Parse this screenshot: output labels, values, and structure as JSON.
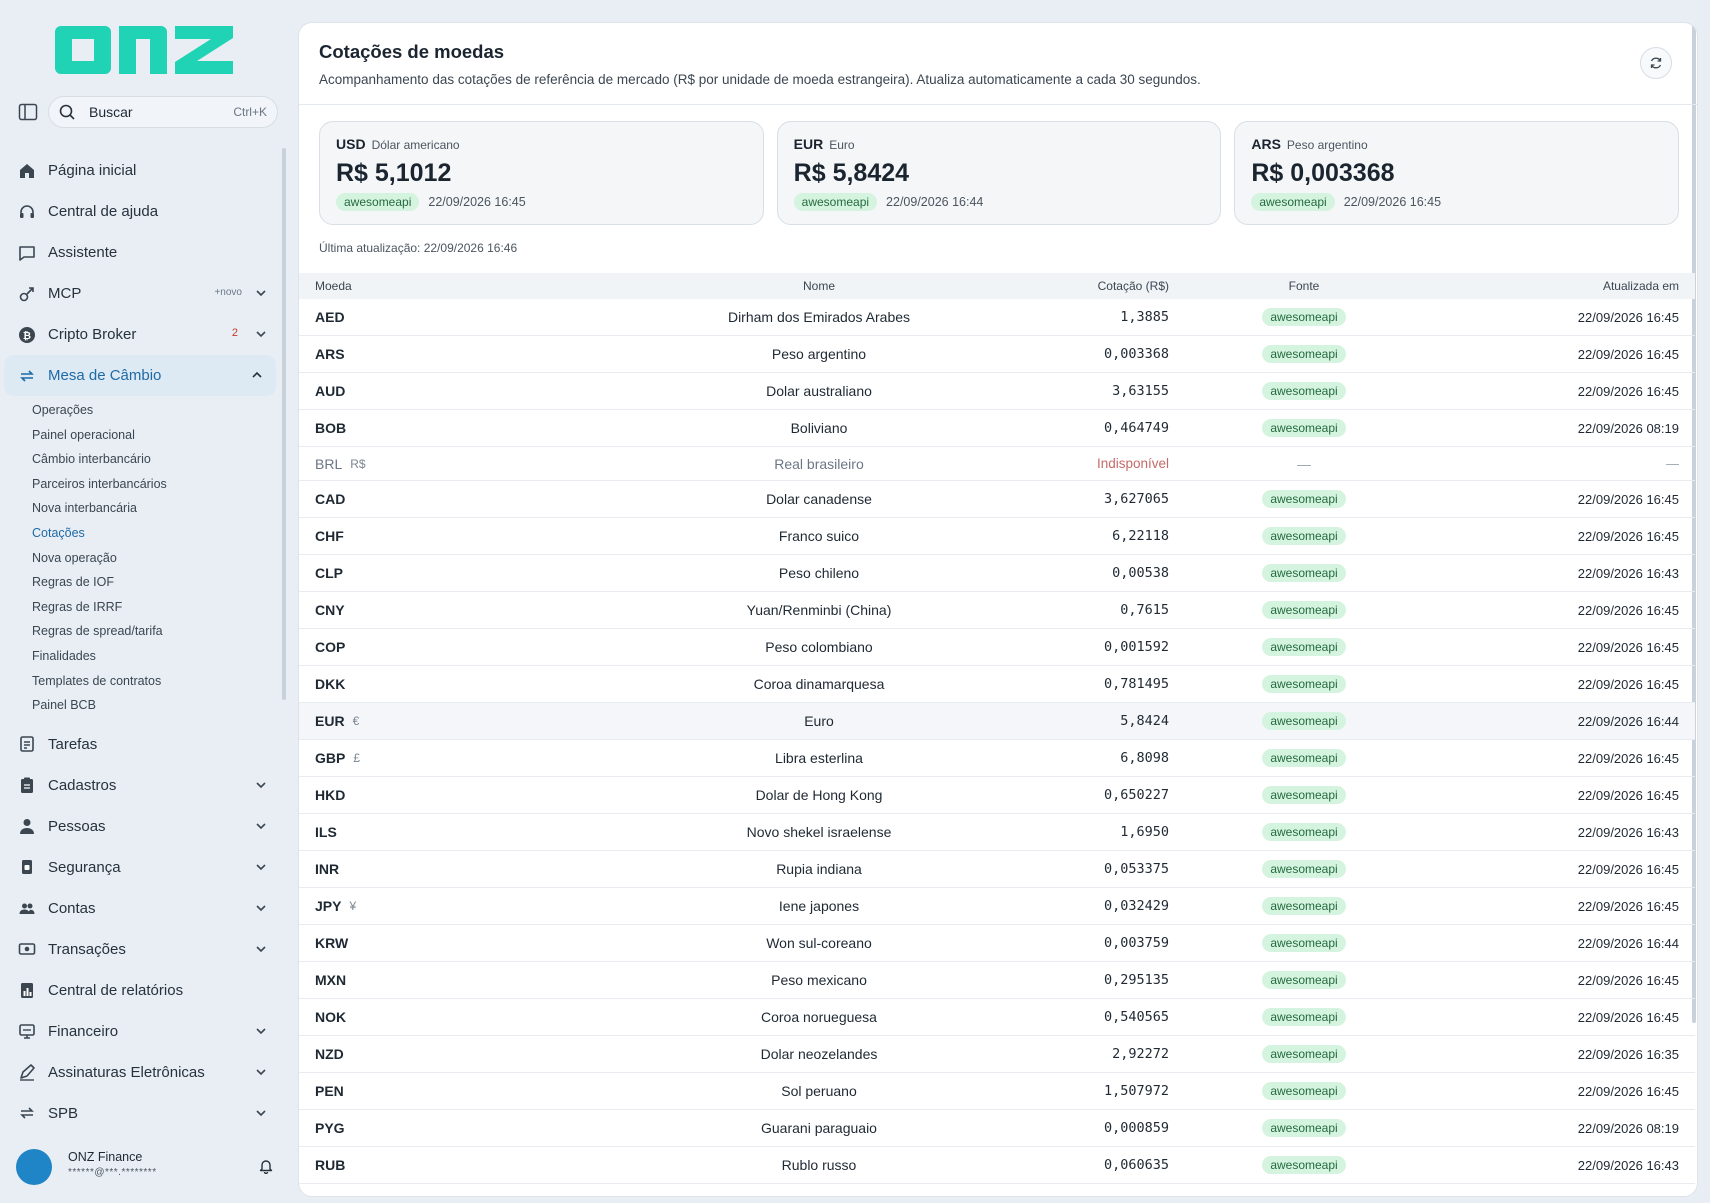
{
  "brand": {
    "logo_text": "onz",
    "color": "#1fd3b4"
  },
  "search": {
    "label": "Buscar",
    "shortcut": "Ctrl+K"
  },
  "nav": {
    "items_top": [
      {
        "label": "Página inicial",
        "icon": "home-icon"
      },
      {
        "label": "Central de ajuda",
        "icon": "headset-icon"
      },
      {
        "label": "Assistente",
        "icon": "chat-icon"
      },
      {
        "label": "MCP",
        "icon": "plug-icon",
        "tag": "+novo"
      },
      {
        "label": "Cripto Broker",
        "icon": "bitcoin-icon",
        "badge": "2"
      },
      {
        "label": "Mesa de Câmbio",
        "icon": "exchange-icon"
      }
    ],
    "sub_items": [
      "Operações",
      "Painel operacional",
      "Câmbio interbancário",
      "Parceiros interbancários",
      "Nova interbancária",
      "Cotações",
      "Nova operação",
      "Regras de IOF",
      "Regras de IRRF",
      "Regras de spread/tarifa",
      "Finalidades",
      "Templates de contratos",
      "Painel BCB"
    ],
    "items_bottom": [
      {
        "label": "Tarefas",
        "icon": "tasks-icon"
      },
      {
        "label": "Cadastros",
        "icon": "clipboard-icon"
      },
      {
        "label": "Pessoas",
        "icon": "person-icon"
      },
      {
        "label": "Segurança",
        "icon": "shield-icon"
      },
      {
        "label": "Contas",
        "icon": "users-icon"
      },
      {
        "label": "Transações",
        "icon": "money-icon"
      },
      {
        "label": "Central de relatórios",
        "icon": "report-icon"
      },
      {
        "label": "Financeiro",
        "icon": "finance-icon"
      },
      {
        "label": "Assinaturas Eletrônicas",
        "icon": "signature-icon"
      },
      {
        "label": "SPB",
        "icon": "transfer-icon"
      }
    ]
  },
  "user": {
    "name": "ONZ Finance",
    "email": "******@***.********"
  },
  "page": {
    "title": "Cotações de moedas",
    "subtitle": "Acompanhamento das cotações de referência de mercado (R$ por unidade de moeda estrangeira). Atualiza automaticamente a cada 30 segundos.",
    "last_update": "Última atualização: 22/09/2026 16:46"
  },
  "cards": [
    {
      "code": "USD",
      "name": "Dólar americano",
      "value": "R$ 5,1012",
      "source": "awesomeapi",
      "time": "22/09/2026 16:45"
    },
    {
      "code": "EUR",
      "name": "Euro",
      "value": "R$ 5,8424",
      "source": "awesomeapi",
      "time": "22/09/2026 16:44"
    },
    {
      "code": "ARS",
      "name": "Peso argentino",
      "value": "R$ 0,003368",
      "source": "awesomeapi",
      "time": "22/09/2026 16:45"
    }
  ],
  "table": {
    "headers": {
      "code": "Moeda",
      "name": "Nome",
      "rate": "Cotação (R$)",
      "source": "Fonte",
      "updated": "Atualizada em"
    },
    "rows": [
      {
        "code": "AED",
        "symbol": "",
        "name": "Dirham dos Emirados Arabes",
        "rate": "1,3885",
        "source": "awesomeapi",
        "updated": "22/09/2026 16:45"
      },
      {
        "code": "ARS",
        "symbol": "",
        "name": "Peso argentino",
        "rate": "0,003368",
        "source": "awesomeapi",
        "updated": "22/09/2026 16:45"
      },
      {
        "code": "AUD",
        "symbol": "",
        "name": "Dolar australiano",
        "rate": "3,63155",
        "source": "awesomeapi",
        "updated": "22/09/2026 16:45"
      },
      {
        "code": "BOB",
        "symbol": "",
        "name": "Boliviano",
        "rate": "0,464749",
        "source": "awesomeapi",
        "updated": "22/09/2026 08:19"
      },
      {
        "code": "BRL",
        "symbol": "R$",
        "name": "Real brasileiro",
        "rate": "Indisponível",
        "source": "—",
        "updated": "—",
        "unavailable": true
      },
      {
        "code": "CAD",
        "symbol": "",
        "name": "Dolar canadense",
        "rate": "3,627065",
        "source": "awesomeapi",
        "updated": "22/09/2026 16:45"
      },
      {
        "code": "CHF",
        "symbol": "",
        "name": "Franco suico",
        "rate": "6,22118",
        "source": "awesomeapi",
        "updated": "22/09/2026 16:45"
      },
      {
        "code": "CLP",
        "symbol": "",
        "name": "Peso chileno",
        "rate": "0,00538",
        "source": "awesomeapi",
        "updated": "22/09/2026 16:43"
      },
      {
        "code": "CNY",
        "symbol": "",
        "name": "Yuan/Renminbi (China)",
        "rate": "0,7615",
        "source": "awesomeapi",
        "updated": "22/09/2026 16:45"
      },
      {
        "code": "COP",
        "symbol": "",
        "name": "Peso colombiano",
        "rate": "0,001592",
        "source": "awesomeapi",
        "updated": "22/09/2026 16:45"
      },
      {
        "code": "DKK",
        "symbol": "",
        "name": "Coroa dinamarquesa",
        "rate": "0,781495",
        "source": "awesomeapi",
        "updated": "22/09/2026 16:45"
      },
      {
        "code": "EUR",
        "symbol": "€",
        "name": "Euro",
        "rate": "5,8424",
        "source": "awesomeapi",
        "updated": "22/09/2026 16:44",
        "highlight": true
      },
      {
        "code": "GBP",
        "symbol": "£",
        "name": "Libra esterlina",
        "rate": "6,8098",
        "source": "awesomeapi",
        "updated": "22/09/2026 16:45"
      },
      {
        "code": "HKD",
        "symbol": "",
        "name": "Dolar de Hong Kong",
        "rate": "0,650227",
        "source": "awesomeapi",
        "updated": "22/09/2026 16:45"
      },
      {
        "code": "ILS",
        "symbol": "",
        "name": "Novo shekel israelense",
        "rate": "1,6950",
        "source": "awesomeapi",
        "updated": "22/09/2026 16:43"
      },
      {
        "code": "INR",
        "symbol": "",
        "name": "Rupia indiana",
        "rate": "0,053375",
        "source": "awesomeapi",
        "updated": "22/09/2026 16:45"
      },
      {
        "code": "JPY",
        "symbol": "¥",
        "name": "Iene japones",
        "rate": "0,032429",
        "source": "awesomeapi",
        "updated": "22/09/2026 16:45"
      },
      {
        "code": "KRW",
        "symbol": "",
        "name": "Won sul-coreano",
        "rate": "0,003759",
        "source": "awesomeapi",
        "updated": "22/09/2026 16:44"
      },
      {
        "code": "MXN",
        "symbol": "",
        "name": "Peso mexicano",
        "rate": "0,295135",
        "source": "awesomeapi",
        "updated": "22/09/2026 16:45"
      },
      {
        "code": "NOK",
        "symbol": "",
        "name": "Coroa norueguesa",
        "rate": "0,540565",
        "source": "awesomeapi",
        "updated": "22/09/2026 16:45"
      },
      {
        "code": "NZD",
        "symbol": "",
        "name": "Dolar neozelandes",
        "rate": "2,92272",
        "source": "awesomeapi",
        "updated": "22/09/2026 16:35"
      },
      {
        "code": "PEN",
        "symbol": "",
        "name": "Sol peruano",
        "rate": "1,507972",
        "source": "awesomeapi",
        "updated": "22/09/2026 16:45"
      },
      {
        "code": "PYG",
        "symbol": "",
        "name": "Guarani paraguaio",
        "rate": "0,000859",
        "source": "awesomeapi",
        "updated": "22/09/2026 08:19"
      },
      {
        "code": "RUB",
        "symbol": "",
        "name": "Rublo russo",
        "rate": "0,060635",
        "source": "awesomeapi",
        "updated": "22/09/2026 16:43"
      }
    ]
  }
}
